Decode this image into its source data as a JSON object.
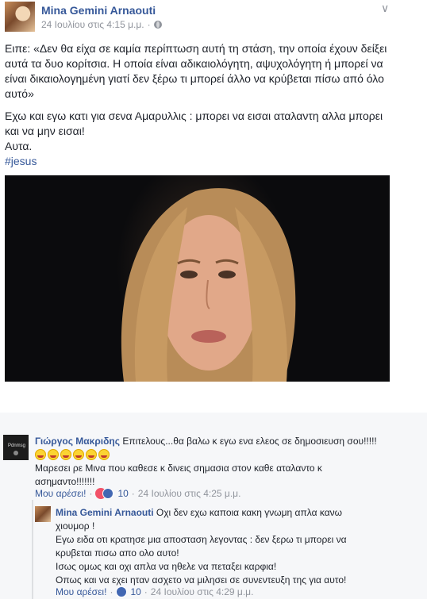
{
  "post": {
    "author": "Mina Gemini Arnaouti",
    "timestamp": "24 Ιουλίου στις 4:15 μ.μ.",
    "privacy_icon": "globe-icon",
    "menu_icon": "chevron-down-icon",
    "paragraph1": "Ειπε: «Δεν θα είχα σε καμία περίπτωση αυτή τη στάση, την οποία έχουν δείξει αυτά τα δυο κορίτσια. Η οποία είναι αδικαιολόγητη, αψυχολόγητη ή μπορεί να είναι δικαιολογημένη γιατί δεν ξέρω τι μπορεί άλλο να κρύβεται πίσω από όλο αυτό»",
    "paragraph2_line1": "Εχω και εγω κατι για σενα Αμαρυλλις : μπορει να εισαι αταλαντη αλλα μπορει και να μην εισαι!",
    "paragraph3": "Αυτα.",
    "hashtag": "#jesus"
  },
  "comments": [
    {
      "author": "Γιώργος Μακριδης",
      "text_part1": "Επιτελους...θα βαλω κ εγω ενα ελεος σε δημοσιευση σου!!!!!",
      "emoji_count": 6,
      "text_part2": "Μαρεσει ρε Μινα που καθεσε κ δινεις σημασια στον καθε αταλαντο κ ασημαντο!!!!!!!",
      "like_label": "Μου αρέσει!",
      "reaction_count": "10",
      "timestamp": "24 Ιουλίου στις 4:25 μ.μ."
    },
    {
      "author": "Mina Gemini Arnaouti",
      "line1": "Οχι δεν εχω καποια κακη γνωμη απλα κανω χιουμορ !",
      "line2": "Εγω ειδα οτι κρατησε μια αποσταση λεγοντας : δεν ξερω τι μπορει να κρυβεται πισω απο ολο αυτο!",
      "line3": "Ισως ομως και οχι απλα να ηθελε να πεταξει καρφια!",
      "line4": "Οπως και να εχει ηταν ασχετο να μιλησει σε συνεντευξη της για αυτο!",
      "like_label": "Μου αρέσει!",
      "reaction_count": "10",
      "timestamp": "24 Ιουλίου στις 4:29 μ.μ."
    }
  ],
  "colors": {
    "link": "#365899",
    "meta": "#90949c",
    "comments_bg": "#f6f7f9"
  }
}
